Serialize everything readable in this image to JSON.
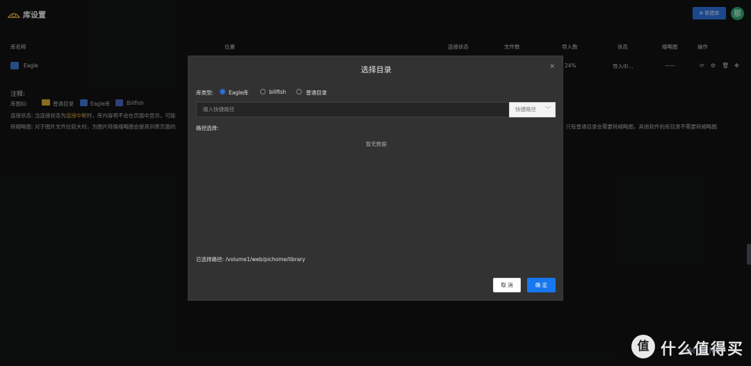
{
  "header": {
    "title": "库设置",
    "new_library_label": "⊕ 新建库",
    "avatar_text": "那"
  },
  "table": {
    "columns": [
      "库名称",
      "位置",
      "连接状态",
      "文件数",
      "导入数",
      "状态",
      "缩略图",
      "操作"
    ],
    "rows": [
      {
        "name": "Eagle",
        "import_count": "24%",
        "status": "导入中...",
        "thumbnail": "——"
      }
    ],
    "op_icons": [
      "refresh-icon",
      "settings-icon",
      "delete-icon",
      "move-icon"
    ]
  },
  "notes": {
    "title": "注释:",
    "icon_label": "库图标:",
    "legend": [
      "普通目录",
      "Eagle库",
      "Billfish"
    ],
    "conn_prefix": "连接状态:    当连接状态为",
    "conn_highlight": "连接中断",
    "conn_suffix": "时，库内容将不会在页面中显示。可能",
    "thumb_text": "转缩略图:    对于图片文件比较大时，为图片转换缩略图会提高列表页面的",
    "thumb_tail": "。只有普通目录会需要转缩略图，其他软件的库目录不需要转缩略图"
  },
  "dialog": {
    "title": "选择目录",
    "close_label": "×",
    "type_label": "库类型:",
    "types": [
      "Eagle库",
      "billfish",
      "普通目录"
    ],
    "selected_type_index": 0,
    "path_placeholder": "输入快捷路径",
    "quick_path_label": "快捷路径",
    "path_select_label": "路径选择:",
    "empty_text": "暂无数据",
    "selected_path_label": "已选择路径: /volume1/web/pichome/library",
    "cancel_label": "取 消",
    "confirm_label": "确 定"
  },
  "watermark": {
    "badge": "值",
    "text": "什么值得买",
    "url": "SMYZ.NET"
  },
  "colors": {
    "accent": "#1677ee",
    "highlight": "#d7a13a",
    "dialog_bg": "#323232"
  }
}
